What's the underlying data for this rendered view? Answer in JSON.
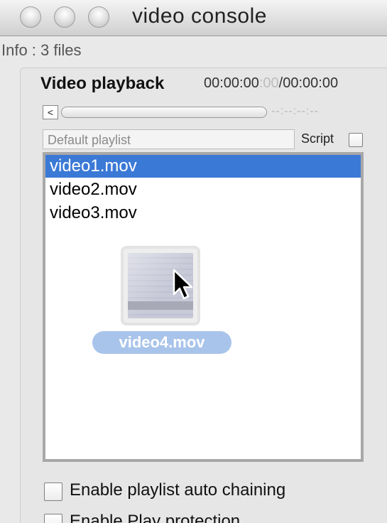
{
  "window": {
    "title": "video console"
  },
  "info": {
    "text": "Info : 3 files"
  },
  "playback": {
    "title": "Video playback",
    "time_current": "00:00:00",
    "time_frames": ":00",
    "time_separator": "/",
    "time_total": "00:00:00",
    "slider_back_label": "<",
    "slider_time": "--:--:--:--"
  },
  "playlist": {
    "name": "Default playlist",
    "script_label": "Script",
    "items": [
      {
        "label": "video1.mov",
        "selected": true
      },
      {
        "label": "video2.mov",
        "selected": false
      },
      {
        "label": "video3.mov",
        "selected": false
      }
    ],
    "drag_item": "video4.mov"
  },
  "options": {
    "auto_chaining": "Enable playlist auto chaining",
    "play_protection": "Enable Play protection"
  },
  "colors": {
    "selection": "#3b79d6",
    "drag_label": "#a9c4ea"
  }
}
